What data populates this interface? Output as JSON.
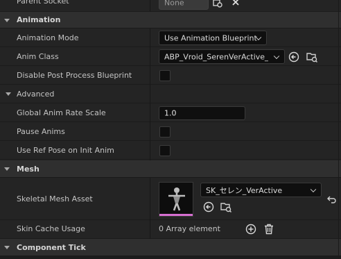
{
  "top": {
    "parent_socket_label": "Parent Socket",
    "parent_socket_value": "None"
  },
  "animation": {
    "title": "Animation",
    "animation_mode_label": "Animation Mode",
    "animation_mode_value": "Use Animation Blueprint",
    "anim_class_label": "Anim Class",
    "anim_class_value": "ABP_Vroid_SerenVerActive_C",
    "disable_post_process_label": "Disable Post Process Blueprint"
  },
  "advanced": {
    "title": "Advanced",
    "global_anim_rate_label": "Global Anim Rate Scale",
    "global_anim_rate_value": "1.0",
    "pause_anims_label": "Pause Anims",
    "use_ref_pose_label": "Use Ref Pose on Init Anim"
  },
  "mesh": {
    "title": "Mesh",
    "skeletal_mesh_label": "Skeletal Mesh Asset",
    "skeletal_mesh_value": "SK_セレン_VerActive",
    "skin_cache_label": "Skin Cache Usage",
    "skin_cache_value": "0 Array element"
  },
  "component_tick": {
    "title": "Component Tick"
  },
  "icons": [
    "browse-icon",
    "clear-icon",
    "use-selected-icon",
    "reset-to-default-icon",
    "add-element-icon",
    "delete-icon",
    "chevron-down-icon",
    "section-arrow-icon"
  ],
  "colors": {
    "panel_bg": "#242424",
    "category_bg": "#2f2f2f",
    "field_bg": "#0f0f0f",
    "thumbnail_accent": "#d66fd0"
  }
}
